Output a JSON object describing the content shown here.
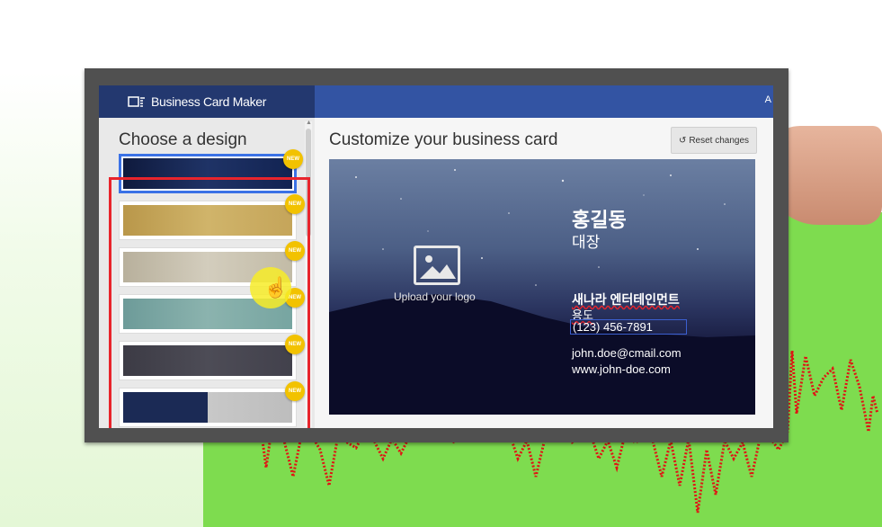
{
  "app": {
    "title": "Business Card Maker",
    "topbar_cut_text": "A"
  },
  "left_panel": {
    "title": "Choose a design",
    "designs": [
      {
        "swatch": "linear-gradient(90deg,#0f1a3d,#1f3366,#122352)",
        "badge": "NEW",
        "selected": true
      },
      {
        "swatch": "linear-gradient(90deg,#b9974a,#d0b46a,#c5a55a)",
        "badge": "NEW",
        "selected": false
      },
      {
        "swatch": "linear-gradient(90deg,#b8b09c,#d3cdbd,#c2bba6)",
        "badge": "NEW",
        "selected": false
      },
      {
        "swatch": "linear-gradient(90deg,#6d9b99,#8bb3ae,#77a5a1)",
        "badge": "NEW",
        "selected": false
      },
      {
        "swatch": "linear-gradient(90deg,#3c3b45,#4d4c56,#42414c)",
        "badge": "NEW",
        "selected": false
      },
      {
        "swatch": "linear-gradient(90deg,#1b2a55 0%,#1b2a55 50%,#c8c8c8 50%,#bdbdbd 100%)",
        "badge": "NEW",
        "selected": false
      }
    ]
  },
  "main": {
    "title": "Customize your business card",
    "reset_label": "Reset changes"
  },
  "card": {
    "logo_label": "Upload your logo",
    "name": "홍길동",
    "position": "대장",
    "company": "새나라 엔터테인먼트",
    "address": "용도",
    "phone": "(123) 456-7891",
    "email": "john.doe@cmail.com",
    "website": "www.john-doe.com"
  },
  "colors": {
    "topbar": "#3354a3",
    "brand_bg": "#23386f",
    "selection_box": "#e8242c",
    "badge": "#f2c200",
    "selected_outline": "#3b72e6"
  }
}
